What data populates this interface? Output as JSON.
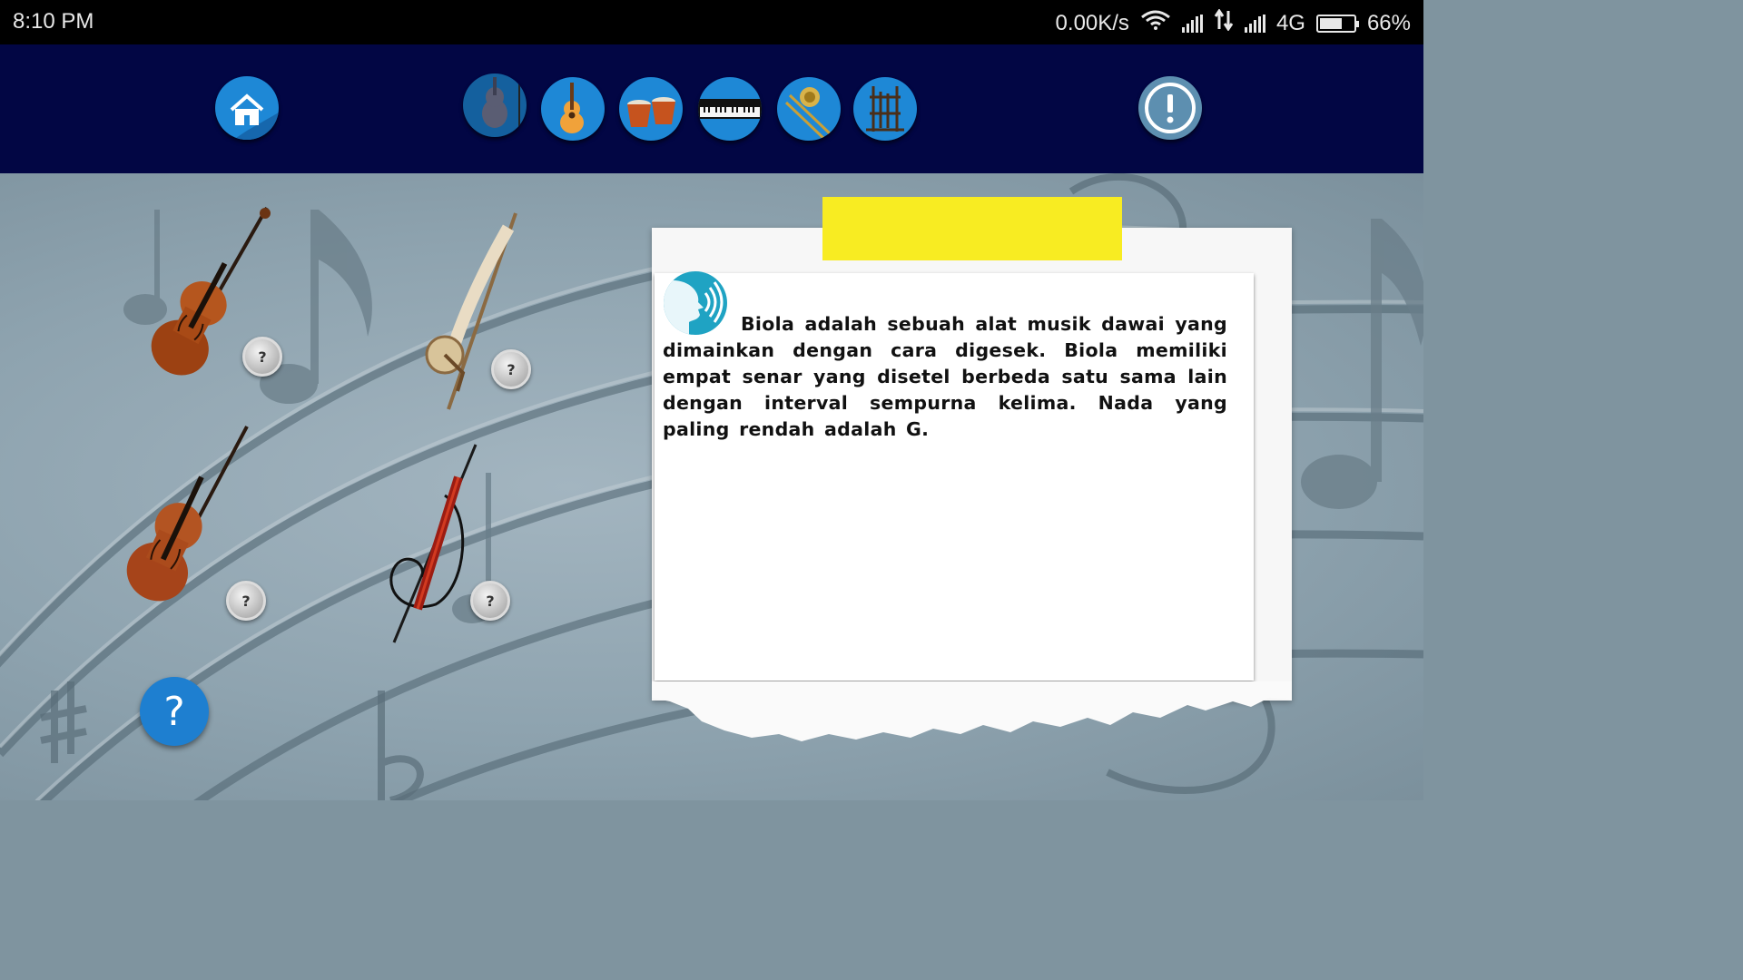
{
  "status_bar": {
    "time": "8:10 PM",
    "network_speed": "0.00K/s",
    "network_type": "4G",
    "battery_percent": "66%",
    "battery_level": 0.66
  },
  "nav": {
    "home_icon": "home-icon",
    "categories": [
      {
        "name": "string-instruments",
        "icon": "violin-icon"
      },
      {
        "name": "guitar",
        "icon": "guitar-icon"
      },
      {
        "name": "percussion",
        "icon": "bongo-drums-icon"
      },
      {
        "name": "keyboard",
        "icon": "keyboard-icon"
      },
      {
        "name": "brass",
        "icon": "trombone-icon"
      },
      {
        "name": "traditional",
        "icon": "angklung-icon"
      }
    ],
    "info_icon": "info-icon"
  },
  "instruments": [
    {
      "name": "violin",
      "hint": "?"
    },
    {
      "name": "rebab",
      "hint": "?"
    },
    {
      "name": "double-bass",
      "hint": "?"
    },
    {
      "name": "electric-cello",
      "hint": "?"
    }
  ],
  "help_label": "?",
  "info_card": {
    "speaker_icon": "speaker-icon",
    "text": "Biola adalah sebuah alat musik dawai yang dimainkan dengan cara digesek. Biola memiliki empat senar yang disetel berbeda satu sama lain dengan interval sempurna kelima. Nada yang paling rendah adalah G."
  },
  "colors": {
    "nav_background": "#020644",
    "button_blue": "#1e88d6",
    "tape_yellow": "#f8ec22",
    "speaker_teal": "#1fa3c3"
  }
}
